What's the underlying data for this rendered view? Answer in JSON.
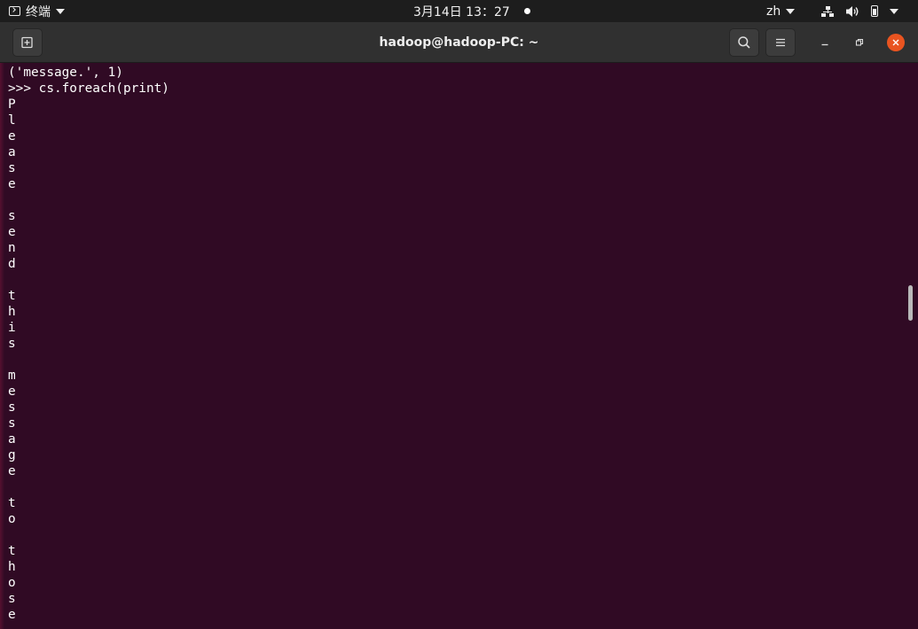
{
  "topbar": {
    "app_name": "终端",
    "clock": "3月14日  13：27",
    "input_method": "zh"
  },
  "window": {
    "title": "hadoop@hadoop-PC: ~"
  },
  "terminal": {
    "lines": [
      "('message.', 1)",
      ">>> cs.foreach(print)",
      "P",
      "l",
      "e",
      "a",
      "s",
      "e",
      "",
      "s",
      "e",
      "n",
      "d",
      "",
      "t",
      "h",
      "i",
      "s",
      "",
      "m",
      "e",
      "s",
      "s",
      "a",
      "g",
      "e",
      "",
      "t",
      "o",
      "",
      "t",
      "h",
      "o",
      "s",
      "e"
    ]
  },
  "colors": {
    "terminal_bg": "#300a24",
    "close_button": "#e95420",
    "headerbar": "#303030",
    "topbar": "#1d1d1d"
  }
}
